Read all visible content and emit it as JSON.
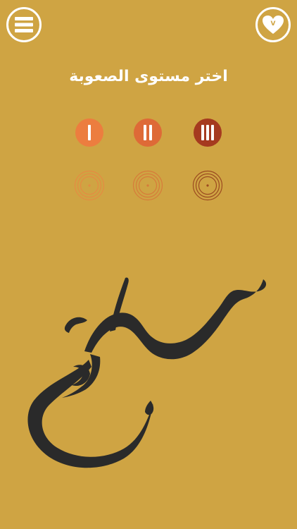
{
  "app": {
    "background_color": "#cfa443"
  },
  "header": {
    "menu_icon": "hamburger-menu-icon",
    "favorite_icon": "heart-icon",
    "favorite_badge": "V"
  },
  "title": "اختر مستوى الصعوبة",
  "levels": [
    {
      "label": "I",
      "color": "#ec7d3f",
      "icon": "level-1-bars-icon"
    },
    {
      "label": "II",
      "color": "#de6a37",
      "icon": "level-2-bars-icon"
    },
    {
      "label": "III",
      "color": "#a53a1f",
      "icon": "level-3-bars-icon"
    }
  ],
  "targets": [
    {
      "color": "#e58b42",
      "icon": "target-icon"
    },
    {
      "color": "#d77b3a",
      "icon": "target-icon"
    },
    {
      "color": "#9c4a20",
      "icon": "target-icon"
    }
  ],
  "calligraphy": {
    "text": "سريع",
    "color": "#2a2a2a"
  }
}
